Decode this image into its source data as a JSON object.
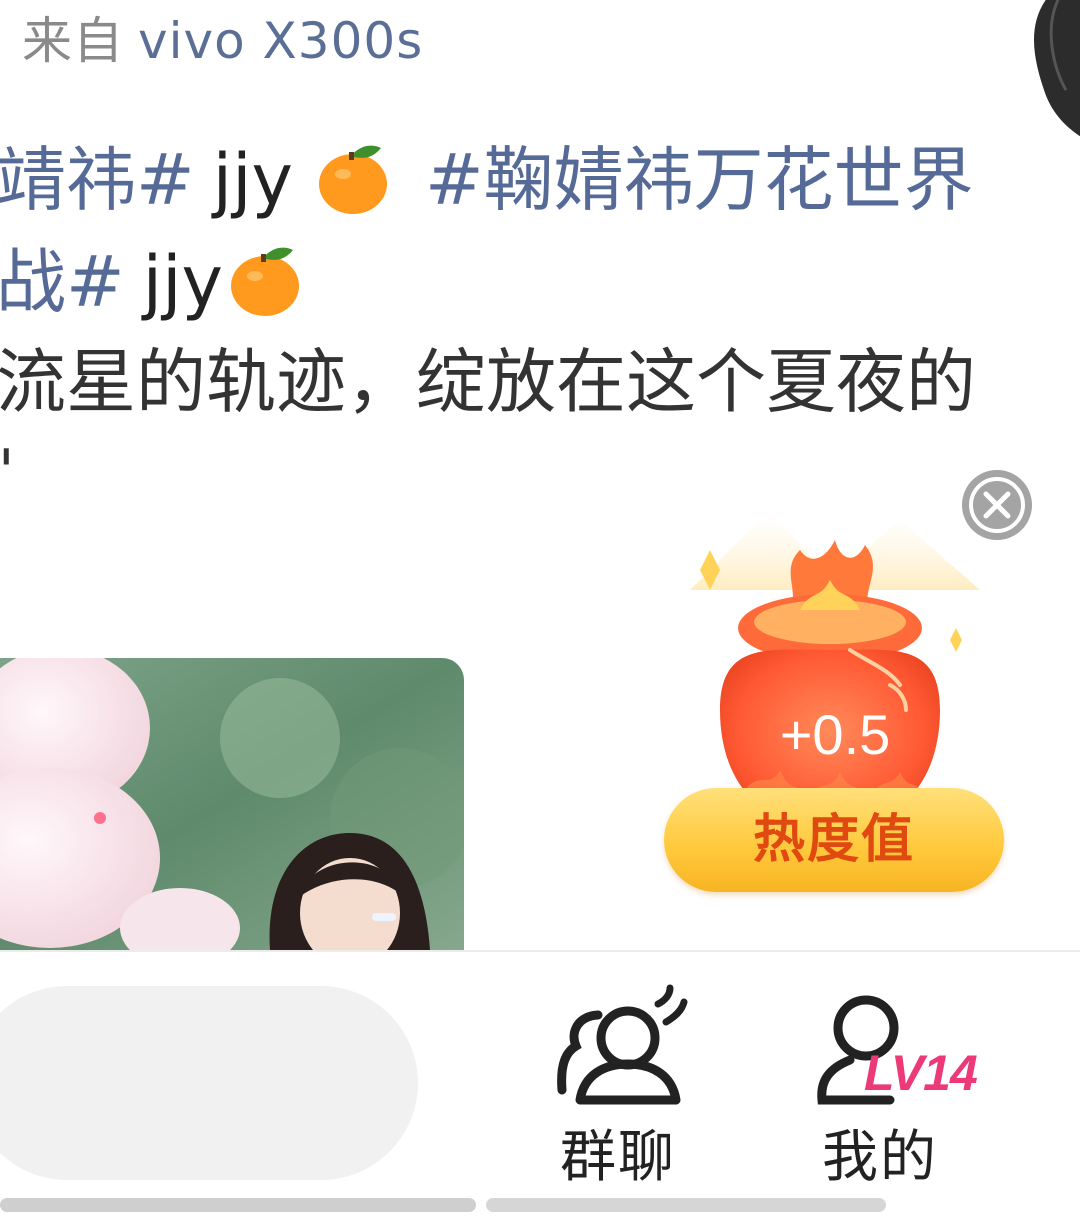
{
  "source": {
    "prefix": "来自",
    "device": "vivo X300s"
  },
  "post": {
    "line1": {
      "topic_a": "靖祎#",
      "text": "jjy",
      "topic_b": "#鞠婧祎万花世界"
    },
    "line2": {
      "topic": "战#",
      "text": "jjy"
    },
    "line3": "流星的轨迹，绽放在这个夏夜的",
    "line4": "'"
  },
  "reward": {
    "value": "+0.5",
    "label": "热度值"
  },
  "bottom_nav": {
    "group_chat": "群聊",
    "mine": "我的",
    "level": "LV14"
  },
  "colors": {
    "topic": "#556a96",
    "level": "#ec3a78",
    "pill_text": "#e04a10"
  }
}
